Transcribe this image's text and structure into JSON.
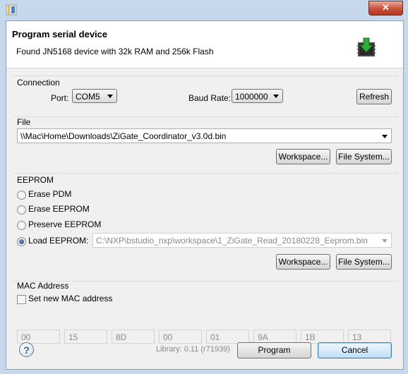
{
  "dialog": {
    "title": "Program serial device",
    "message": "Found JN5168 device with 32k RAM and 256k Flash",
    "close_icon": "close-icon"
  },
  "connection": {
    "legend": "Connection",
    "port_label": "Port:",
    "port_value": "COM5",
    "baud_label": "Baud Rate:",
    "baud_value": "1000000",
    "refresh_label": "Refresh"
  },
  "file": {
    "legend": "File",
    "path": "\\\\Mac\\Home\\Downloads\\ZiGate_Coordinator_v3.0d.bin",
    "workspace_label": "Workspace...",
    "filesystem_label": "File System..."
  },
  "eeprom": {
    "legend": "EEPROM",
    "options": [
      "Erase PDM",
      "Erase EEPROM",
      "Preserve EEPROM",
      "Load EEPROM:"
    ],
    "selected": "Load EEPROM:",
    "path": "C:\\NXP\\bstudio_nxp\\workspace\\1_ZiGate_Read_20180228_Eeprom.bin",
    "workspace_label": "Workspace...",
    "filesystem_label": "File System..."
  },
  "mac": {
    "legend": "MAC Address",
    "checkbox_label": "Set new MAC address",
    "checked": false,
    "bytes": [
      "00",
      "15",
      "8D",
      "00",
      "01",
      "9A",
      "1B",
      "13"
    ]
  },
  "footer": {
    "library": "Library: 0.11 (r71939)",
    "program_label": "Program",
    "cancel_label": "Cancel",
    "help_icon": "help-icon"
  }
}
